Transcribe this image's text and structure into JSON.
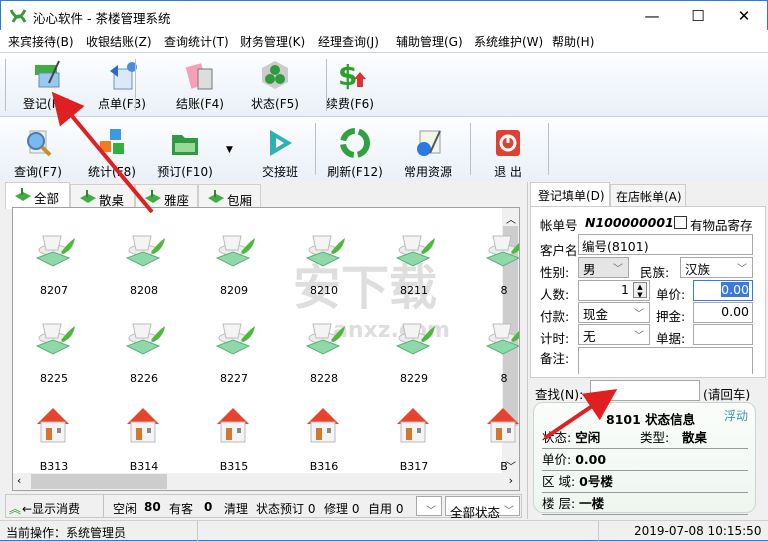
{
  "window": {
    "title": "沁心软件 - 茶楼管理系统",
    "minimize": "—",
    "maximize": "☐",
    "close": "✕"
  },
  "menu": [
    "来宾接待(B)",
    "收银结账(Z)",
    "查询统计(T)",
    "财务管理(K)",
    "经理查询(J)",
    "辅助管理(G)",
    "系统维护(W)",
    "帮助(H)"
  ],
  "toolbar1": [
    {
      "label": "登记(F2)",
      "icon": "register-icon"
    },
    {
      "label": "点单(F3)",
      "icon": "order-icon"
    },
    {
      "label": "结账(F4)",
      "icon": "checkout-icon"
    },
    {
      "label": "状态(F5)",
      "icon": "status-icon"
    },
    {
      "label": "续费(F6)",
      "icon": "renew-fee-icon"
    }
  ],
  "toolbar2": [
    {
      "label": "查询(F7)",
      "icon": "query-icon"
    },
    {
      "label": "统计(F8)",
      "icon": "statistics-icon"
    },
    {
      "label": "预订(F10)",
      "icon": "reserve-icon"
    },
    {
      "label": "交接班",
      "icon": "shift-handover-icon"
    },
    {
      "label": "刷新(F12)",
      "icon": "refresh-icon"
    },
    {
      "label": "常用资源",
      "icon": "resources-icon"
    },
    {
      "label": "退  出",
      "icon": "exit-icon"
    }
  ],
  "tabs": [
    "全部",
    "散桌",
    "雅座",
    "包厢"
  ],
  "rooms": [
    {
      "row": [
        "8207",
        "8208",
        "8209",
        "8210",
        "8211",
        "8"
      ],
      "type": "cup"
    },
    {
      "row": [
        "8225",
        "8226",
        "8227",
        "8228",
        "8229",
        "8"
      ],
      "type": "cup"
    },
    {
      "row": [
        "B313",
        "B314",
        "B315",
        "B316",
        "B317",
        "B"
      ],
      "type": "house"
    }
  ],
  "statusrow": {
    "toggle": "←显示消费",
    "idle": "空闲",
    "idle_n": "80",
    "occupied": "有客",
    "occupied_n": "0",
    "clean": "清理",
    "reserve": "状态预订 0",
    "repair": "修理 0",
    "self": "自用 0",
    "filter": "全部状态"
  },
  "right": {
    "tabs": [
      "登记填单(D)",
      "在店帐单(A)"
    ],
    "bill_label": "帐单号",
    "bill_no": "N100000001",
    "deposit_items": "有物品寄存",
    "customer_label": "客户名",
    "customer": "编号(8101)",
    "gender_label": "性别:",
    "gender": "男",
    "ethnic_label": "民族:",
    "ethnic": "汉族",
    "people_label": "人数:",
    "people": "1",
    "price_label": "单价:",
    "price": "0.00",
    "pay_label": "付款:",
    "pay": "现金",
    "deposit_label": "押金:",
    "deposit": "0.00",
    "timing_label": "计时:",
    "timing": "无",
    "receipt_label": "单据:",
    "receipt": "",
    "note_label": "备注:",
    "find_label": "查找(N):",
    "find_hint": "(请回车)",
    "find_value": ""
  },
  "info": {
    "title": "8101 状态信息",
    "float": "浮动",
    "state_label": "状态:",
    "state": "空闲",
    "type_label": "类型:",
    "type": "散桌",
    "price_label": "单价:",
    "price": "0.00",
    "area_label": "区    域:",
    "area": "0号楼",
    "floor_label": "楼    层:",
    "floor": "一楼"
  },
  "statusbar": {
    "operator": "当前操作：系统管理员",
    "datetime": "2019-07-08 10:15:50"
  },
  "colors": {
    "accent": "#2b79d8",
    "arrow": "#e02020",
    "leaf": "#3fae3f",
    "roof": "#e8442c"
  }
}
